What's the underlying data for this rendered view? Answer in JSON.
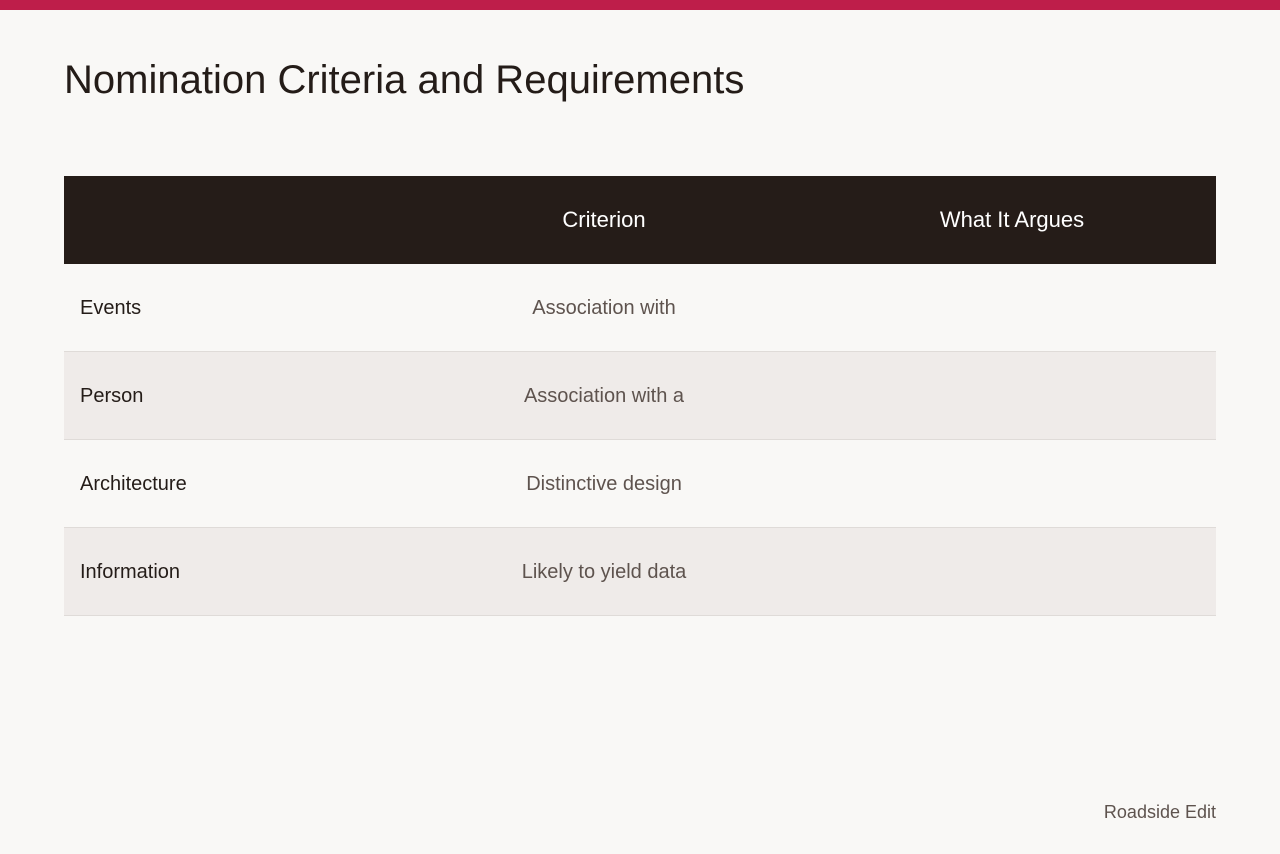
{
  "page": {
    "title": "Nomination Criteria and Requirements",
    "accent_color": "#be1e4a",
    "header_bg": "#251c18"
  },
  "table": {
    "headers": [
      "",
      "Criterion",
      "What It Argues"
    ],
    "rows": [
      {
        "label": "Events",
        "criterion": "Association with",
        "argues": ""
      },
      {
        "label": "Person",
        "criterion": "Association with a",
        "argues": ""
      },
      {
        "label": "Architecture",
        "criterion": "Distinctive design",
        "argues": ""
      },
      {
        "label": "Information",
        "criterion": "Likely to yield data",
        "argues": ""
      }
    ]
  },
  "footer": {
    "brand": "Roadside Edit"
  }
}
